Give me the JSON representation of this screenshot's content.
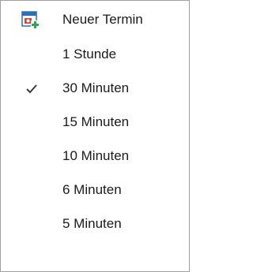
{
  "menu": {
    "new_appointment": {
      "label": "Neuer Termin",
      "icon": "calendar-add-icon"
    },
    "items": [
      {
        "label": "1 Stunde",
        "checked": false
      },
      {
        "label": "30 Minuten",
        "checked": true
      },
      {
        "label": "15 Minuten",
        "checked": false
      },
      {
        "label": "10 Minuten",
        "checked": false
      },
      {
        "label": "6 Minuten",
        "checked": false
      },
      {
        "label": "5 Minuten",
        "checked": false
      }
    ],
    "check_icon": "checkmark-icon",
    "colors": {
      "check": "#3c3c3c",
      "icon_red": "#d9423a",
      "icon_blue": "#2f6fb7",
      "icon_green": "#2aa84a"
    }
  }
}
